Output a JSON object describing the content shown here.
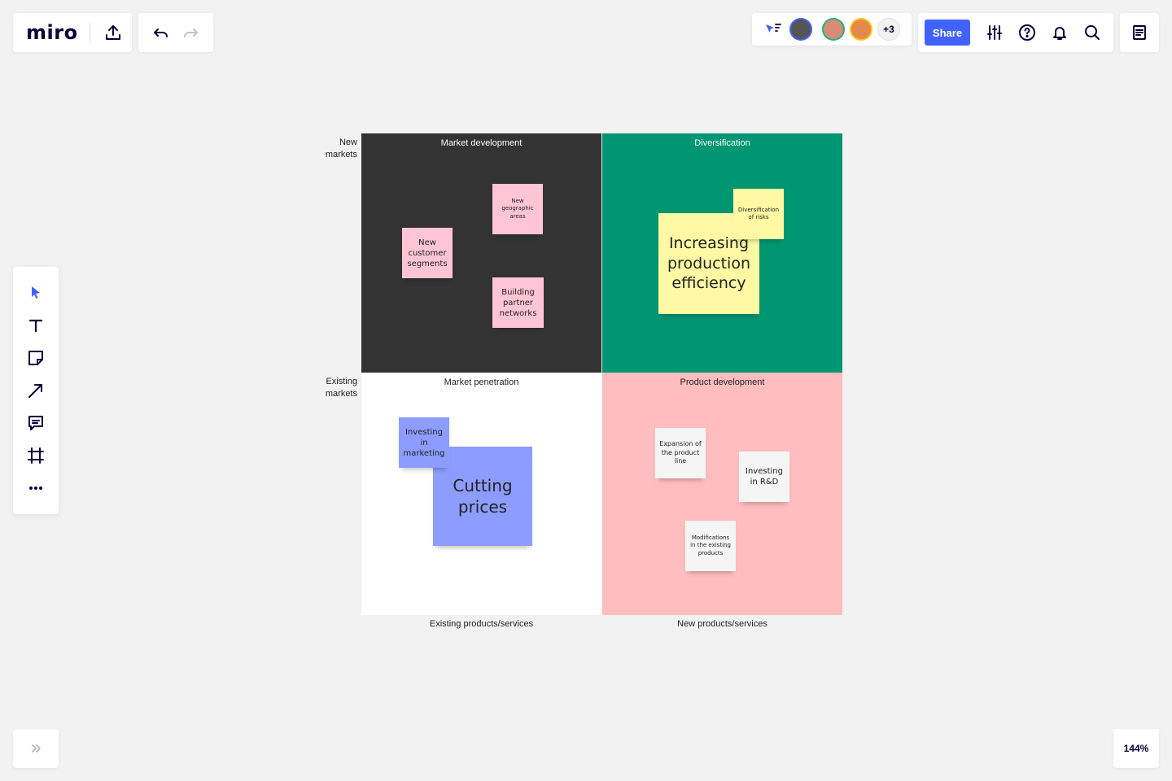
{
  "app": {
    "logo": "miro"
  },
  "header": {
    "share_label": "Share",
    "extra_collaborators": "+3",
    "zoom": "144%"
  },
  "board": {
    "axis_left_top": "New\nmarkets",
    "axis_left_bottom": "Existing\nmarkets",
    "axis_bottom_left": "Existing products/services",
    "axis_bottom_right": "New products/services",
    "quadrants": {
      "tl": {
        "title": "Market development",
        "color": "#333333"
      },
      "tr": {
        "title": "Diversification",
        "color": "#009672"
      },
      "bl": {
        "title": "Market penetration",
        "color": "#ffffff"
      },
      "br": {
        "title": "Product development",
        "color": "#ffbdbf"
      }
    },
    "stickies": {
      "new_geo": "New geographic areas",
      "new_customer": "New customer segments",
      "building_partner": "Building partner networks",
      "increasing": "Increasing production efficiency",
      "div_risks": "Diversification of risks",
      "investing_marketing": "Investing in marketing",
      "cutting_prices": "Cutting prices",
      "expansion": "Expansion of the product line",
      "investing_rd": "Investing in R&D",
      "modifications": "Modifications in the existing products"
    }
  },
  "colors": {
    "accent": "#4262ff",
    "pink_sticky": "#ffc5d6",
    "yellow_sticky": "#fff9a3",
    "blue_sticky": "#8d9cff",
    "white_sticky": "#f5f5f5"
  }
}
